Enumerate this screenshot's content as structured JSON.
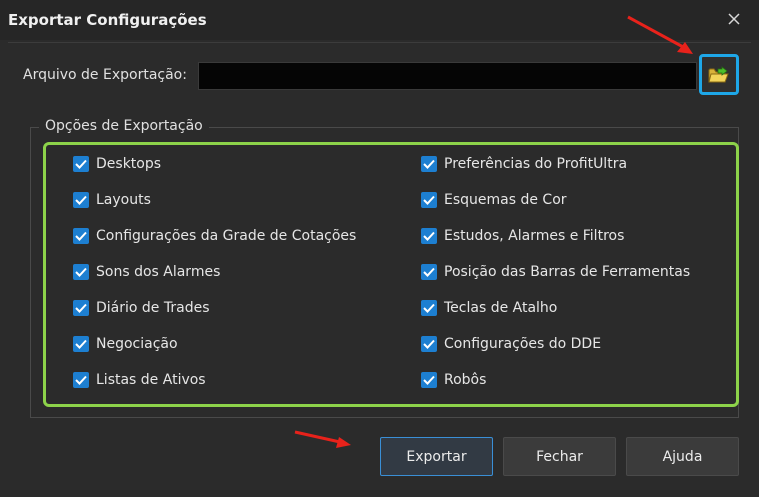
{
  "window": {
    "title": "Exportar Configurações",
    "close_icon": "close-icon"
  },
  "file": {
    "label": "Arquivo de Exportação:",
    "value": ""
  },
  "group": {
    "title": "Opções de Exportação",
    "left": [
      {
        "label": "Desktops",
        "checked": true
      },
      {
        "label": "Layouts",
        "checked": true
      },
      {
        "label": "Configurações da Grade de Cotações",
        "checked": true
      },
      {
        "label": "Sons dos Alarmes",
        "checked": true
      },
      {
        "label": "Diário de Trades",
        "checked": true
      },
      {
        "label": "Negociação",
        "checked": true
      },
      {
        "label": "Listas de Ativos",
        "checked": true
      }
    ],
    "right": [
      {
        "label": "Preferências do ProfitUltra",
        "checked": true
      },
      {
        "label": "Esquemas de Cor",
        "checked": true
      },
      {
        "label": "Estudos, Alarmes e Filtros",
        "checked": true
      },
      {
        "label": "Posição das Barras de Ferramentas",
        "checked": true
      },
      {
        "label": "Teclas de Atalho",
        "checked": true
      },
      {
        "label": "Configurações do DDE",
        "checked": true
      },
      {
        "label": "Robôs",
        "checked": true
      }
    ]
  },
  "buttons": {
    "export": "Exportar",
    "close": "Fechar",
    "help": "Ajuda"
  },
  "colors": {
    "accent": "#1ea7e8",
    "highlight": "#8dd34a",
    "checkbox": "#1d7fd1",
    "arrow": "#e8221b"
  }
}
